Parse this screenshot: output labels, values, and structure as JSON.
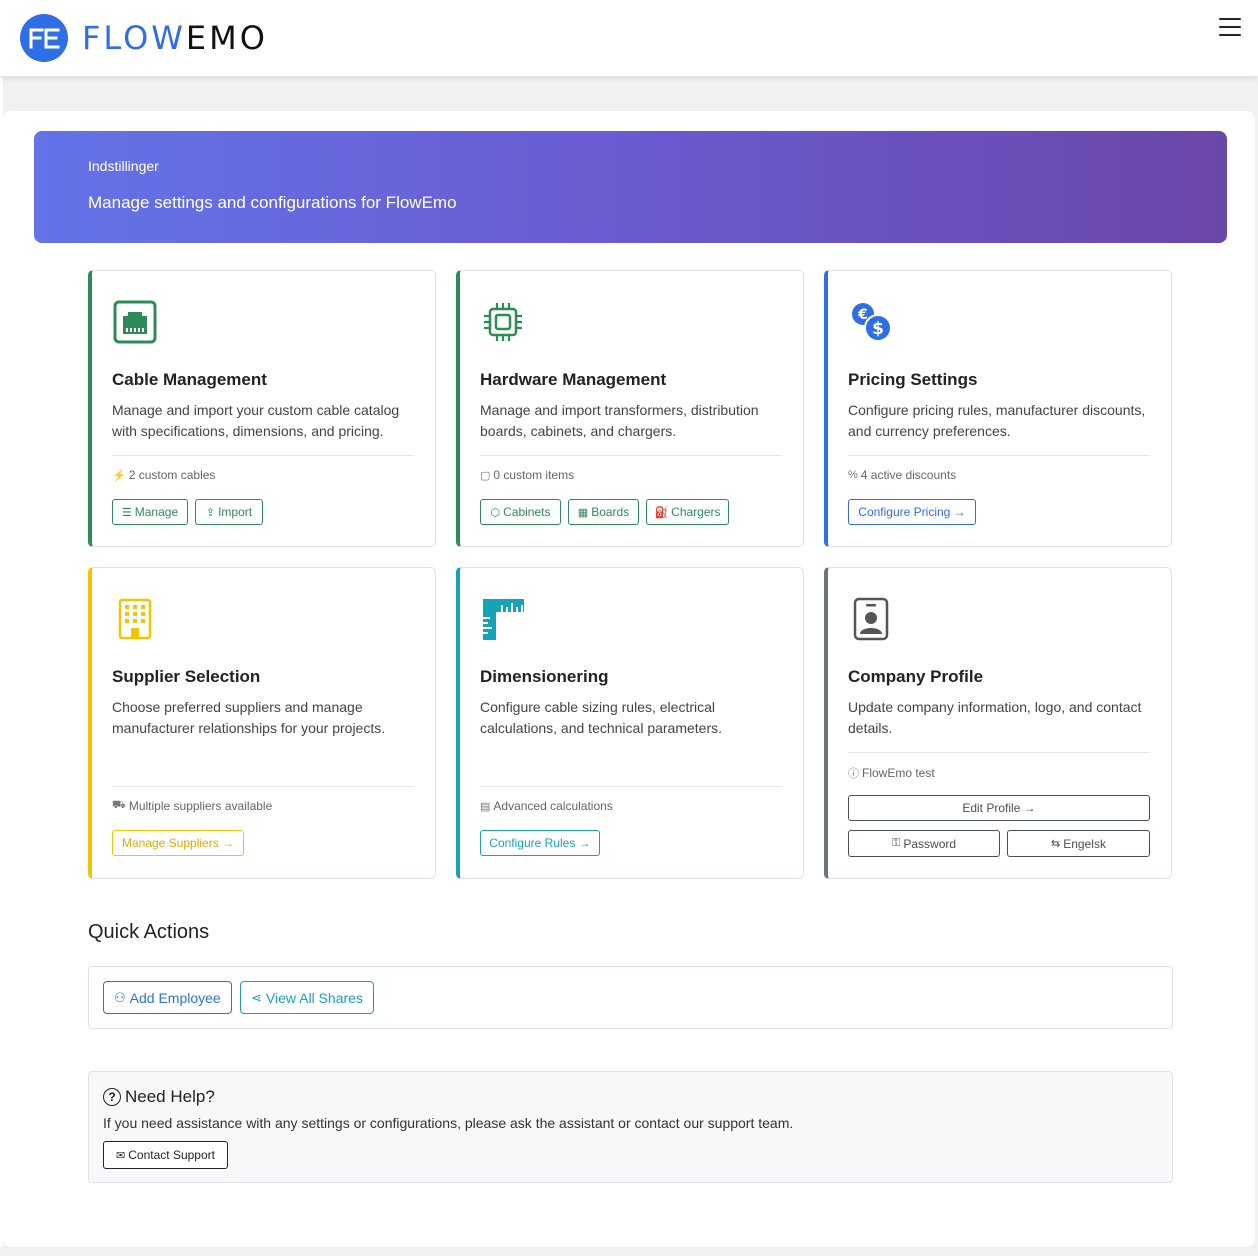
{
  "navbar": {
    "logo_initials": "FE",
    "brand_part1": "FLOW",
    "brand_part2": "EMO",
    "brand_color": "#2f6ee6",
    "menu_icon": "hamburger-icon"
  },
  "banner": {
    "title": "Indstillinger",
    "subtitle": "Manage settings and configurations for FlowEmo",
    "gradient": [
      "#6473e8",
      "#6b47a8"
    ]
  },
  "cards": [
    {
      "title": "Cable Management",
      "description": "Manage and import your custom cable catalog with specifications, dimensions, and pricing.",
      "meta": "2 custom cables",
      "meta_icon": "lightning-icon",
      "icon": "ethernet-icon",
      "accent": "#2e8b57",
      "buttons": [
        "Manage",
        "Import"
      ]
    },
    {
      "title": "Hardware Management",
      "description": "Manage and import transformers, distribution boards, cabinets, and chargers.",
      "meta": "0 custom items",
      "meta_icon": "box-icon",
      "icon": "cpu-icon",
      "accent": "#2e8b57",
      "buttons": [
        "Cabinets",
        "Boards",
        "Chargers"
      ]
    },
    {
      "title": "Pricing Settings",
      "description": "Configure pricing rules, manufacturer discounts, and currency preferences.",
      "meta": "4 active discounts",
      "meta_icon": "percent-icon",
      "icon": "currency-exchange-icon",
      "accent": "#2f6ee6",
      "buttons": [
        "Configure Pricing →"
      ]
    },
    {
      "title": "Supplier Selection",
      "description": "Choose preferred suppliers and manage manufacturer relationships for your projects.",
      "meta": "Multiple suppliers available",
      "meta_icon": "truck-icon",
      "icon": "building-icon",
      "accent": "#f5c400",
      "buttons": [
        "Manage Suppliers →"
      ]
    },
    {
      "title": "Dimensionering",
      "description": "Configure cable sizing rules, electrical calculations, and technical parameters.",
      "meta": "Advanced calculations",
      "meta_icon": "calculator-icon",
      "icon": "rulers-icon",
      "accent": "#17a2b8",
      "buttons": [
        "Configure Rules →"
      ]
    },
    {
      "title": "Company Profile",
      "description": "Update company information, logo, and contact details.",
      "meta": "FlowEmo test",
      "meta_icon": "info-icon",
      "icon": "person-badge-icon",
      "accent": "#6c757d",
      "buttons": [
        "Edit Profile →",
        "Password",
        "Engelsk"
      ]
    }
  ],
  "quick_actions": {
    "title": "Quick Actions",
    "add_employee": "Add Employee",
    "view_all_shares": "View All Shares"
  },
  "help": {
    "title": "Need Help?",
    "text": "If you need assistance with any settings or configurations, please ask the assistant or contact our support team.",
    "button": "Contact Support"
  }
}
